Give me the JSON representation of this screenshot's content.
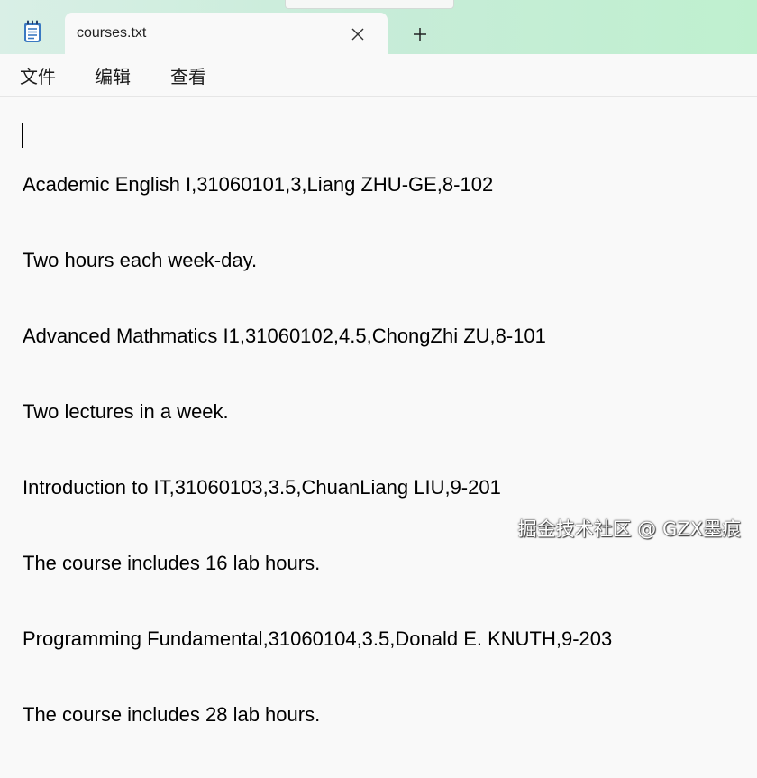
{
  "window": {
    "tab_title": "courses.txt"
  },
  "icons": {
    "app": "notepad-icon",
    "close": "close-icon",
    "add": "plus-icon"
  },
  "menu": {
    "items": [
      {
        "label": "文件"
      },
      {
        "label": "编辑"
      },
      {
        "label": "查看"
      }
    ]
  },
  "editor": {
    "lines": [
      "Academic English I,31060101,3,Liang ZHU-GE,8-102",
      "Two hours each week-day.",
      "Advanced Mathmatics I1,31060102,4.5,ChongZhi ZU,8-101",
      "Two lectures in a week.",
      "Introduction to IT,31060103,3.5,ChuanLiang LIU,9-201",
      "The course includes 16 lab hours.",
      "Programming Fundamental,31060104,3.5,Donald E. KNUTH,9-203",
      "The course includes 28 lab hours."
    ]
  },
  "watermark": {
    "text": "掘金技术社区 @ GZX墨痕"
  },
  "colors": {
    "titlebar": "#c7ecd8",
    "background": "#f9f9f9",
    "icon_blue": "#2f6fb5"
  }
}
